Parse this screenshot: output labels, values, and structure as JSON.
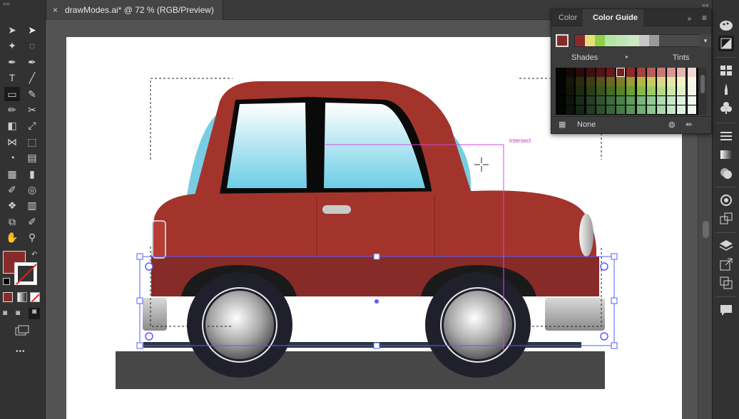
{
  "document": {
    "tab_title": "drawModes.ai* @ 72 % (RGB/Preview)",
    "close_glyph": "×",
    "collapse_glyph": "««"
  },
  "tools": [
    "selection-tool-icon",
    "direct-selection-tool-icon",
    "magic-wand-tool-icon",
    "lasso-tool-icon",
    "pen-tool-icon",
    "curvature-tool-icon",
    "type-tool-icon",
    "line-segment-tool-icon",
    "rectangle-tool-icon",
    "paintbrush-tool-icon",
    "pencil-tool-icon",
    "scissors-tool-icon",
    "reflect-tool-icon",
    "scale-tool-icon",
    "width-tool-icon",
    "free-transform-tool-icon",
    "shape-builder-tool-icon",
    "perspective-grid-tool-icon",
    "mesh-tool-icon",
    "gradient-tool-icon",
    "eyedropper-tool-icon",
    "blend-tool-icon",
    "symbol-sprayer-tool-icon",
    "column-graph-tool-icon",
    "artboard-tool-icon",
    "slice-tool-icon",
    "hand-tool-icon",
    "zoom-tool-icon"
  ],
  "fill_stroke": {
    "fill_color": "#872b28",
    "stroke": "none"
  },
  "more_tools_glyph": "•••",
  "panel": {
    "tab_color": "Color",
    "tab_color_guide": "Color Guide",
    "collapse_glyph": "»",
    "menu_glyph": "≡",
    "harmony_dropdown_glyph": "▾",
    "shades_label": "Shades",
    "tints_label": "Tints",
    "none_label": "None",
    "base_color": "#872b28",
    "harmony_colors": [
      "#8b2a2a",
      "#e6e07a",
      "#8ed04a",
      "#b6e6a6",
      "#bfe6b7",
      "#cce8c4",
      "#c7c7c7",
      "#9a9a9a",
      "#4a4a4a"
    ],
    "grid_colors": [
      [
        "#050505",
        "#160808",
        "#2a0c0b",
        "#3d100f",
        "#501513",
        "#641a17",
        "#78201c",
        "#8a2a27",
        "#a3423e",
        "#b65c59",
        "#c87875",
        "#d89694",
        "#e8b5b3",
        "#f4d6d5"
      ],
      [
        "#050505",
        "#151508",
        "#2a2a0e",
        "#3e3e14",
        "#53531b",
        "#686822",
        "#7e7e2a",
        "#9a9a36",
        "#b4b44a",
        "#c9c964",
        "#dada84",
        "#e7e7a6",
        "#f2f2c8",
        "#f8f8e4"
      ],
      [
        "#050505",
        "#0e1508",
        "#1c2a0e",
        "#2a3f15",
        "#38551c",
        "#476b23",
        "#56822b",
        "#6a9e36",
        "#84b84c",
        "#9ccc66",
        "#b4dc88",
        "#cbe8aa",
        "#e0f2cc",
        "#eff8e6"
      ],
      [
        "#050505",
        "#0c140c",
        "#182a18",
        "#243f24",
        "#305530",
        "#3c6b3c",
        "#4a824a",
        "#5b9e5b",
        "#74b874",
        "#90cc90",
        "#addcad",
        "#c7e8c7",
        "#dff2df",
        "#eff8ef"
      ],
      [
        "#050505",
        "#0c130c",
        "#172617",
        "#233a23",
        "#2f4e2f",
        "#3b633b",
        "#497949",
        "#5a935a",
        "#73ad73",
        "#8fc38f",
        "#abd6ab",
        "#c6e4c6",
        "#def1de",
        "#eef8ee"
      ]
    ]
  },
  "canvas": {
    "annotation": "intersect"
  }
}
